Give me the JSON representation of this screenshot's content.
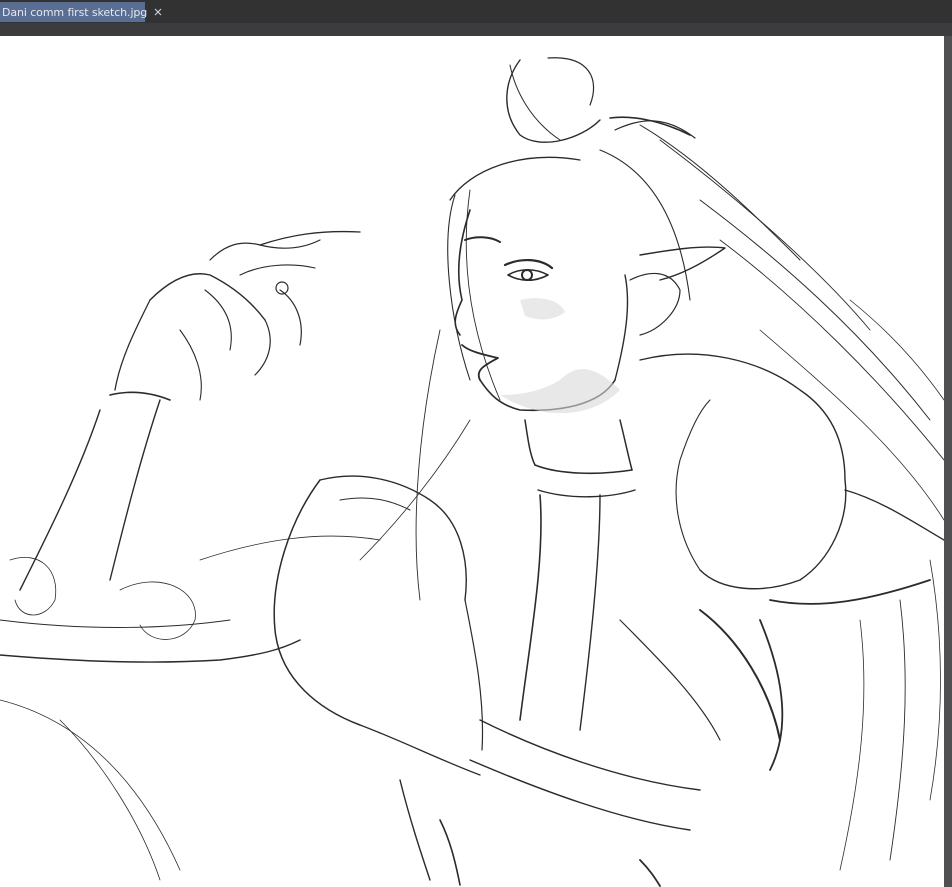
{
  "window": {
    "tab": {
      "title": "Dani comm first sketch.jpg",
      "close_icon": "close-icon"
    }
  },
  "colors": {
    "tab_active": "#596e92",
    "tab_bar": "#323233",
    "workspace": "#3a3a3c",
    "canvas": "#ffffff"
  },
  "canvas": {
    "content": "pencil sketch artwork"
  }
}
